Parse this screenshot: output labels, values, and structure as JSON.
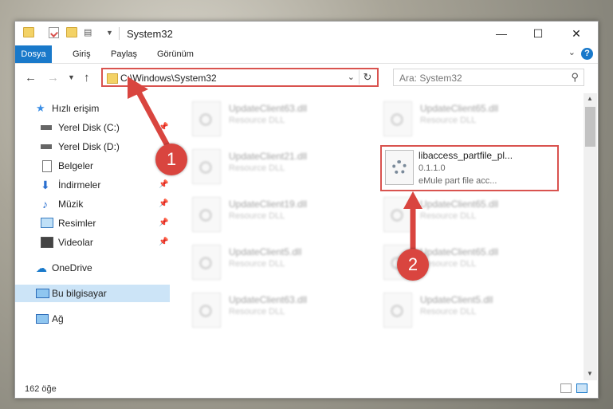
{
  "window": {
    "title": "System32",
    "controls": {
      "minimize": "—",
      "maximize": "☐",
      "close": "✕"
    }
  },
  "ribbon": {
    "tabs": [
      "Dosya",
      "Giriş",
      "Paylaş",
      "Görünüm"
    ],
    "help": "?"
  },
  "navigation": {
    "address": "C:\\Windows\\System32",
    "search_placeholder": "Ara: System32"
  },
  "sidebar": {
    "items": [
      {
        "label": "Hızlı erişim",
        "icon": "star-icon"
      },
      {
        "label": "Yerel Disk (C:)",
        "icon": "drive-icon",
        "pinned": true
      },
      {
        "label": "Yerel Disk (D:)",
        "icon": "drive-icon"
      },
      {
        "label": "Belgeler",
        "icon": "document-icon",
        "pinned": true
      },
      {
        "label": "İndirmeler",
        "icon": "download-icon",
        "pinned": true
      },
      {
        "label": "Müzik",
        "icon": "music-icon",
        "pinned": true
      },
      {
        "label": "Resimler",
        "icon": "pictures-icon",
        "pinned": true
      },
      {
        "label": "Videolar",
        "icon": "videos-icon",
        "pinned": true
      },
      {
        "label": "OneDrive",
        "icon": "cloud-icon"
      },
      {
        "label": "Bu bilgisayar",
        "icon": "computer-icon",
        "selected": true
      },
      {
        "label": "Ağ",
        "icon": "network-icon"
      }
    ]
  },
  "files": [
    {
      "name": "UpdateClient63.dll",
      "desc": "Resource DLL"
    },
    {
      "name": "UpdateClient65.dll",
      "desc": "Resource DLL"
    },
    {
      "name": "UpdateClient21.dll",
      "desc": "Resource DLL"
    },
    {
      "name": "UpdateClient19.dll",
      "desc": "Resource DLL"
    },
    {
      "name": "UpdateClient65.dll",
      "desc": "Resource DLL"
    },
    {
      "name": "UpdateClient5.dll",
      "desc": "Resource DLL"
    },
    {
      "name": "UpdateClient65.dll",
      "desc": "Resource DLL"
    },
    {
      "name": "UpdateClient63.dll",
      "desc": "Resource DLL"
    },
    {
      "name": "UpdateClient5.dll",
      "desc": "Resource DLL"
    }
  ],
  "highlighted_file": {
    "name": "libaccess_partfile_pl...",
    "version": "0.1.1.0",
    "desc": "eMule part file acc..."
  },
  "status": {
    "count": "162 öğe"
  },
  "callouts": [
    "1",
    "2"
  ],
  "colors": {
    "accent": "#1979ca",
    "annotation": "#d9453f"
  }
}
